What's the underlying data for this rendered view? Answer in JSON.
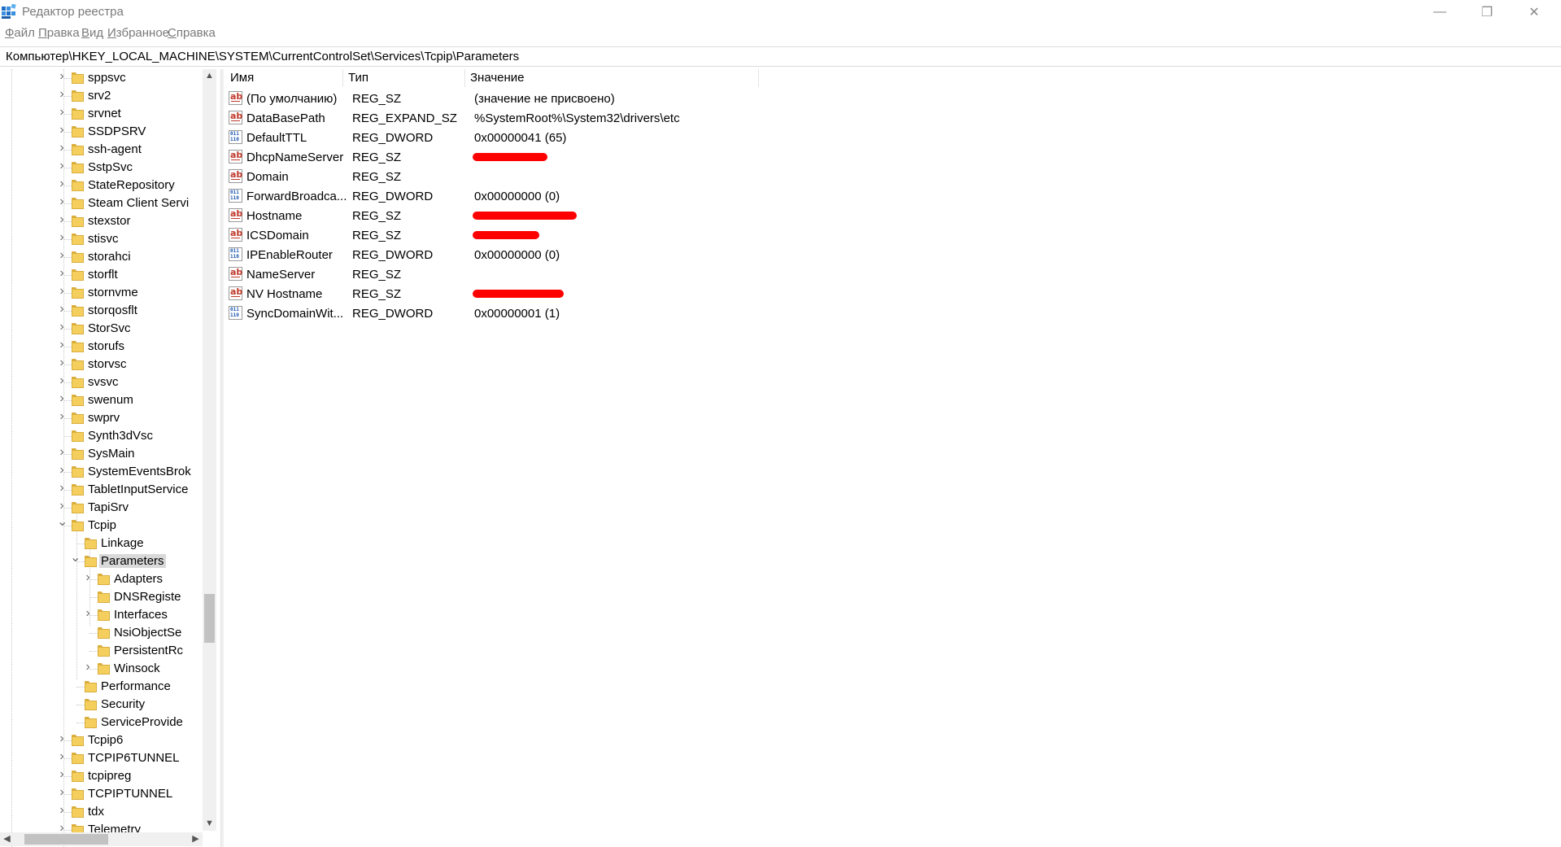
{
  "window": {
    "title": "Редактор реестра",
    "minimize_glyph": "—",
    "maximize_glyph": "❐",
    "close_glyph": "✕"
  },
  "menu": [
    {
      "accel": "Ф",
      "rest": "айл"
    },
    {
      "accel": "П",
      "rest": "равка"
    },
    {
      "accel": "В",
      "rest": "ид"
    },
    {
      "accel": "И",
      "rest": "збранное"
    },
    {
      "accel": "С",
      "rest": "правка"
    }
  ],
  "address": "Компьютер\\HKEY_LOCAL_MACHINE\\SYSTEM\\CurrentControlSet\\Services\\Tcpip\\Parameters",
  "tree": {
    "items": [
      {
        "label": "sppsvc",
        "level": 0,
        "expander": "collapsed"
      },
      {
        "label": "srv2",
        "level": 0,
        "expander": "collapsed"
      },
      {
        "label": "srvnet",
        "level": 0,
        "expander": "collapsed"
      },
      {
        "label": "SSDPSRV",
        "level": 0,
        "expander": "collapsed"
      },
      {
        "label": "ssh-agent",
        "level": 0,
        "expander": "collapsed"
      },
      {
        "label": "SstpSvc",
        "level": 0,
        "expander": "collapsed"
      },
      {
        "label": "StateRepository",
        "level": 0,
        "expander": "collapsed"
      },
      {
        "label": "Steam Client Servi",
        "level": 0,
        "expander": "collapsed"
      },
      {
        "label": "stexstor",
        "level": 0,
        "expander": "collapsed"
      },
      {
        "label": "stisvc",
        "level": 0,
        "expander": "collapsed"
      },
      {
        "label": "storahci",
        "level": 0,
        "expander": "collapsed"
      },
      {
        "label": "storflt",
        "level": 0,
        "expander": "collapsed"
      },
      {
        "label": "stornvme",
        "level": 0,
        "expander": "collapsed"
      },
      {
        "label": "storqosflt",
        "level": 0,
        "expander": "collapsed"
      },
      {
        "label": "StorSvc",
        "level": 0,
        "expander": "collapsed"
      },
      {
        "label": "storufs",
        "level": 0,
        "expander": "collapsed"
      },
      {
        "label": "storvsc",
        "level": 0,
        "expander": "collapsed"
      },
      {
        "label": "svsvc",
        "level": 0,
        "expander": "collapsed"
      },
      {
        "label": "swenum",
        "level": 0,
        "expander": "collapsed"
      },
      {
        "label": "swprv",
        "level": 0,
        "expander": "collapsed"
      },
      {
        "label": "Synth3dVsc",
        "level": 0,
        "expander": "none"
      },
      {
        "label": "SysMain",
        "level": 0,
        "expander": "collapsed"
      },
      {
        "label": "SystemEventsBrok",
        "level": 0,
        "expander": "collapsed"
      },
      {
        "label": "TabletInputService",
        "level": 0,
        "expander": "collapsed"
      },
      {
        "label": "TapiSrv",
        "level": 0,
        "expander": "collapsed"
      },
      {
        "label": "Tcpip",
        "level": 0,
        "expander": "expanded"
      },
      {
        "label": "Linkage",
        "level": 1,
        "expander": "none"
      },
      {
        "label": "Parameters",
        "level": 1,
        "expander": "expanded",
        "selected": true
      },
      {
        "label": "Adapters",
        "level": 2,
        "expander": "collapsed"
      },
      {
        "label": "DNSRegiste",
        "level": 2,
        "expander": "none"
      },
      {
        "label": "Interfaces",
        "level": 2,
        "expander": "collapsed"
      },
      {
        "label": "NsiObjectSe",
        "level": 2,
        "expander": "none"
      },
      {
        "label": "PersistentRc",
        "level": 2,
        "expander": "none"
      },
      {
        "label": "Winsock",
        "level": 2,
        "expander": "collapsed"
      },
      {
        "label": "Performance",
        "level": 1,
        "expander": "none"
      },
      {
        "label": "Security",
        "level": 1,
        "expander": "none"
      },
      {
        "label": "ServiceProvide",
        "level": 1,
        "expander": "none"
      },
      {
        "label": "Tcpip6",
        "level": 0,
        "expander": "collapsed"
      },
      {
        "label": "TCPIP6TUNNEL",
        "level": 0,
        "expander": "collapsed"
      },
      {
        "label": "tcpipreg",
        "level": 0,
        "expander": "collapsed"
      },
      {
        "label": "TCPIPTUNNEL",
        "level": 0,
        "expander": "collapsed"
      },
      {
        "label": "tdx",
        "level": 0,
        "expander": "collapsed"
      },
      {
        "label": "Telemetry",
        "level": 0,
        "expander": "collapsed"
      }
    ],
    "scroll_up_glyph": "▲",
    "scroll_down_glyph": "▼",
    "scroll_left_glyph": "◀",
    "scroll_right_glyph": "▶"
  },
  "list": {
    "columns": [
      "Имя",
      "Тип",
      "Значение"
    ],
    "rows": [
      {
        "icon": "string-value-icon",
        "name": "(По умолчанию)",
        "type": "REG_SZ",
        "data": "(значение не присвоено)"
      },
      {
        "icon": "string-value-icon",
        "name": "DataBasePath",
        "type": "REG_EXPAND_SZ",
        "data": "%SystemRoot%\\System32\\drivers\\etc"
      },
      {
        "icon": "binary-value-icon",
        "name": "DefaultTTL",
        "type": "REG_DWORD",
        "data": "0x00000041 (65)"
      },
      {
        "icon": "string-value-icon",
        "name": "DhcpNameServer",
        "type": "REG_SZ",
        "data": "",
        "redacted": true
      },
      {
        "icon": "string-value-icon",
        "name": "Domain",
        "type": "REG_SZ",
        "data": ""
      },
      {
        "icon": "binary-value-icon",
        "name": "ForwardBroadca...",
        "type": "REG_DWORD",
        "data": "0x00000000 (0)"
      },
      {
        "icon": "string-value-icon",
        "name": "Hostname",
        "type": "REG_SZ",
        "data": "",
        "redacted": true
      },
      {
        "icon": "string-value-icon",
        "name": "ICSDomain",
        "type": "REG_SZ",
        "data": "",
        "redacted": true
      },
      {
        "icon": "binary-value-icon",
        "name": "IPEnableRouter",
        "type": "REG_DWORD",
        "data": "0x00000000 (0)"
      },
      {
        "icon": "string-value-icon",
        "name": "NameServer",
        "type": "REG_SZ",
        "data": ""
      },
      {
        "icon": "string-value-icon",
        "name": "NV Hostname",
        "type": "REG_SZ",
        "data": "",
        "redacted": true
      },
      {
        "icon": "binary-value-icon",
        "name": "SyncDomainWit...",
        "type": "REG_DWORD",
        "data": "0x00000001 (1)"
      }
    ]
  },
  "colors": {
    "redaction": "#ff0000",
    "selection": "#d9d9d9",
    "folder": "#f5cf5d"
  }
}
